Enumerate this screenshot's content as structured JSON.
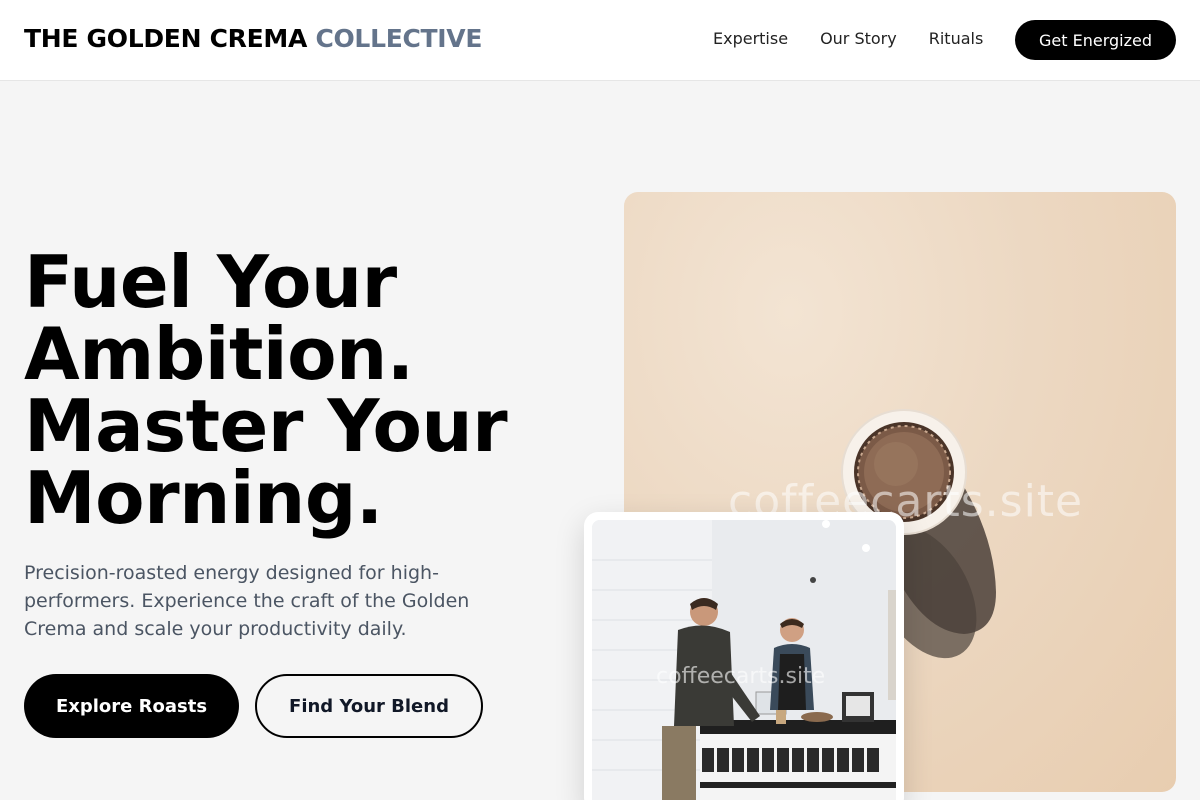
{
  "header": {
    "brand_primary": "THE GOLDEN CREMA",
    "brand_accent": "COLLECTIVE",
    "nav": [
      "Expertise",
      "Our Story",
      "Rituals"
    ],
    "cta_label": "Get Energized"
  },
  "hero": {
    "headline_lines": [
      "Fuel Your",
      "Ambition.",
      "Master Your",
      "Morning."
    ],
    "subtitle": "Precision-roasted energy designed for high-performers. Experience the craft of the Golden Crema and scale your productivity daily.",
    "primary_button": "Explore Roasts",
    "secondary_button": "Find Your Blend"
  },
  "images": {
    "main_watermark": "coffeecarts.site",
    "inset_watermark": "coffeecarts.site",
    "main_icon": "coffee-cup-top-view",
    "inset_icon": "coffee-shop-counter-scene"
  },
  "colors": {
    "brand_accent": "#64748b",
    "primary_button_bg": "#000000",
    "page_bg": "#f5f5f5",
    "subtitle_text": "#4b5563"
  }
}
